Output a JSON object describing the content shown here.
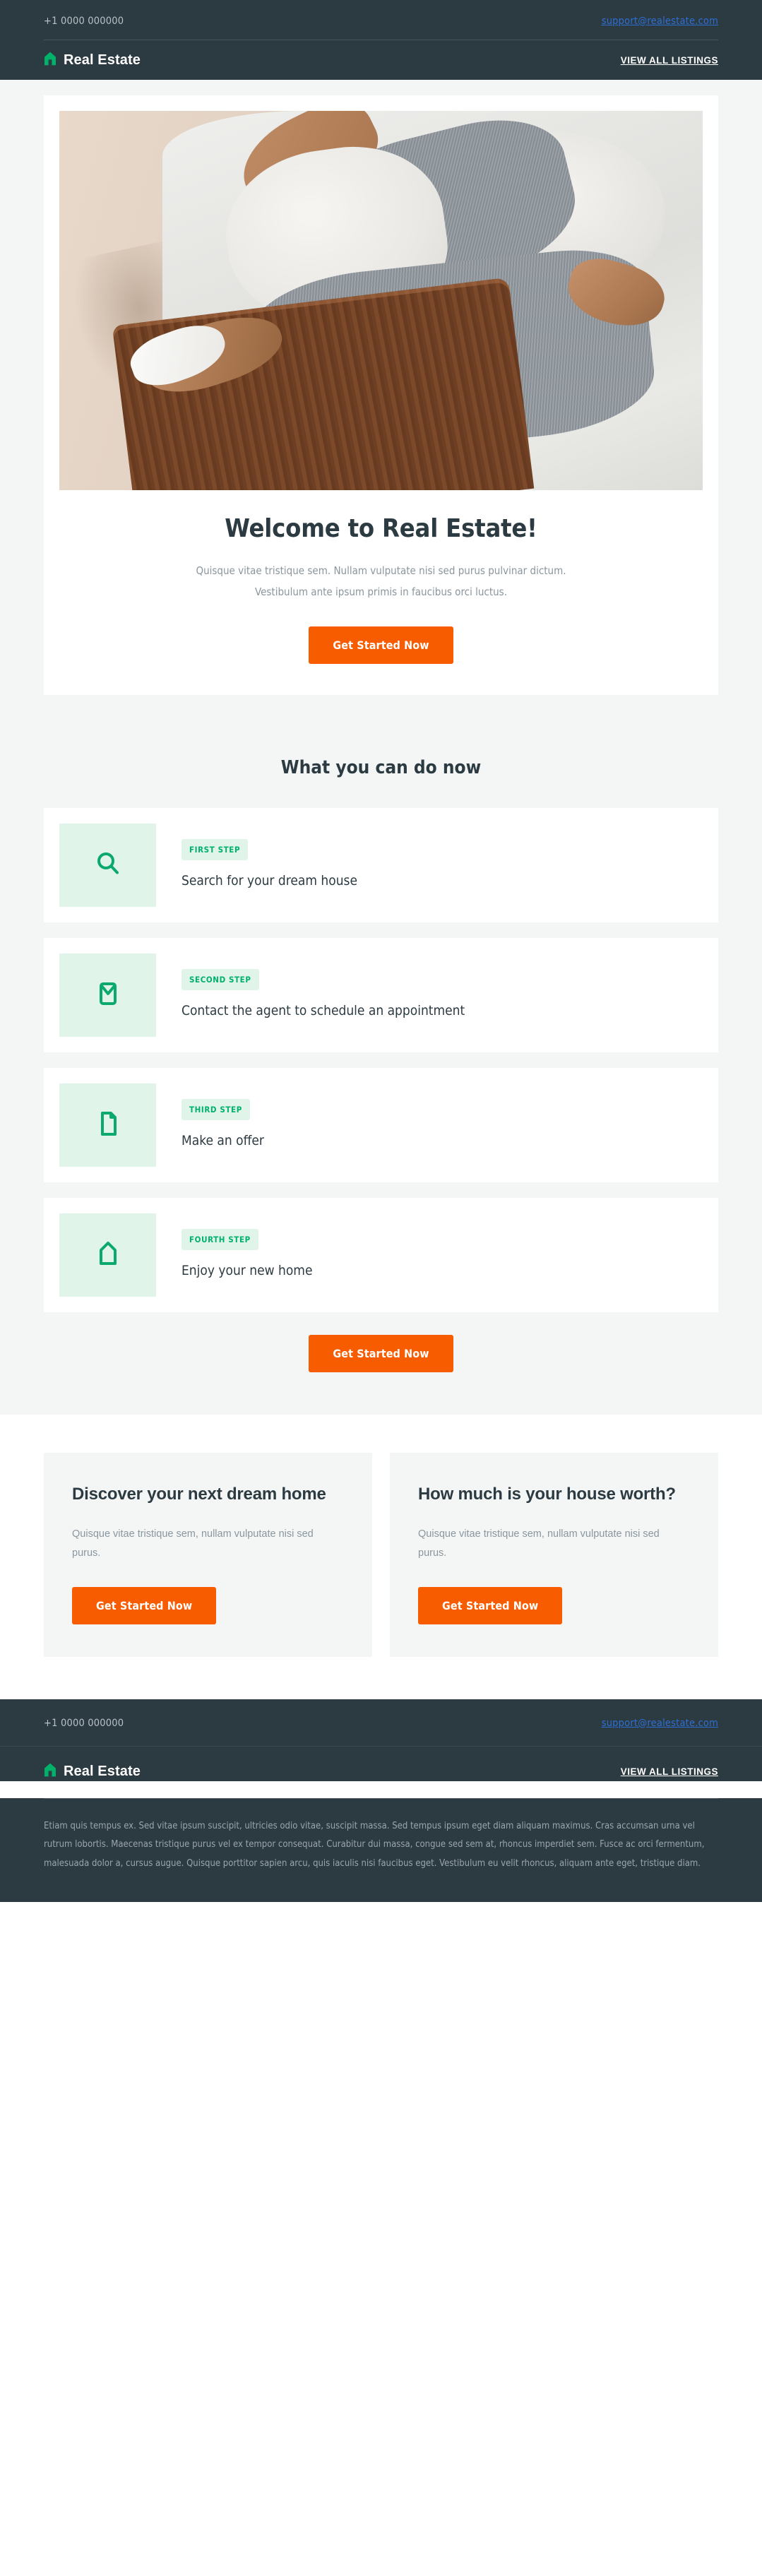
{
  "brand": {
    "name": "Real Estate",
    "logo_icon": "house-icon",
    "accent_green": "#00B16A",
    "accent_orange": "#F85C00",
    "dark": "#2C3A42",
    "page_bg": "#F4F6F6"
  },
  "topbar": {
    "phone": "+1 0000 000000",
    "email": "support@realestate.com",
    "email_color": "#2E6FD4"
  },
  "nav": {
    "cta_label": "VIEW ALL LISTINGS"
  },
  "hero": {
    "image_alt": "person relaxing on a couch in grey knitwear",
    "title": "Welcome to Real Estate!",
    "subtitle_line1": "Quisque vitae tristique sem. Nullam vulputate nisi sed purus pulvinar dictum.",
    "subtitle_line2": "Vestibulum ante ipsum primis in faucibus orci luctus.",
    "cta_label": "Get Started Now"
  },
  "steps_section": {
    "title": "What you can do now",
    "cta_label": "Get Started Now",
    "items": [
      {
        "badge": "FIRST STEP",
        "text": "Search for your dream house",
        "icon": "search-icon"
      },
      {
        "badge": "SECOND STEP",
        "text": "Contact the agent to schedule an appointment",
        "icon": "envelope-icon"
      },
      {
        "badge": "THIRD STEP",
        "text": "Make an offer",
        "icon": "document-icon"
      },
      {
        "badge": "FOURTH STEP",
        "text": "Enjoy your new home",
        "icon": "house-icon"
      }
    ]
  },
  "features": [
    {
      "title": "Discover your next dream home",
      "text": "Quisque vitae tristique sem, nullam vulputate nisi sed purus.",
      "cta_label": "Get Started Now"
    },
    {
      "title": "How much is your house worth?",
      "text": "Quisque vitae tristique sem, nullam vulputate nisi sed purus.",
      "cta_label": "Get Started Now"
    }
  ],
  "footer": {
    "phone": "+1 0000 000000",
    "email": "support@realestate.com",
    "brand_name": "Real Estate",
    "cta_label": "VIEW ALL LISTINGS",
    "legal": "Etiam quis tempus ex. Sed vitae ipsum suscipit, ultricies odio vitae, suscipit massa. Sed tempus ipsum eget diam aliquam maximus. Cras accumsan urna vel rutrum lobortis. Maecenas tristique purus vel ex tempor consequat. Curabitur dui massa, congue sed sem at, rhoncus imperdiet sem. Fusce ac orci fermentum, malesuada dolor a, cursus augue. Quisque porttitor sapien arcu, quis iaculis nisi faucibus eget. Vestibulum eu velit rhoncus, aliquam ante eget, tristique diam."
  }
}
